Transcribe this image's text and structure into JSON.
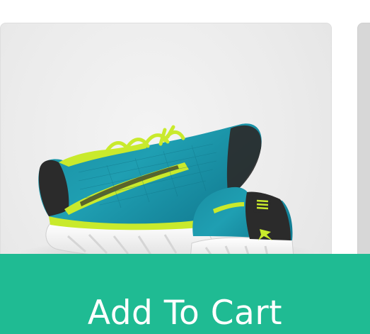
{
  "product": {
    "image_icon": "running-shoe-image",
    "brand_logo_icon": "sparx-logo-icon",
    "colors": {
      "shoe_body": "#1f93a6",
      "shoe_accent": "#c9ea2c",
      "shoe_dark": "#2b2b2b",
      "sole": "#f7f7f7",
      "background": "#ececec"
    }
  },
  "cta": {
    "label": "Add To Cart",
    "background": "#1fbb93"
  }
}
